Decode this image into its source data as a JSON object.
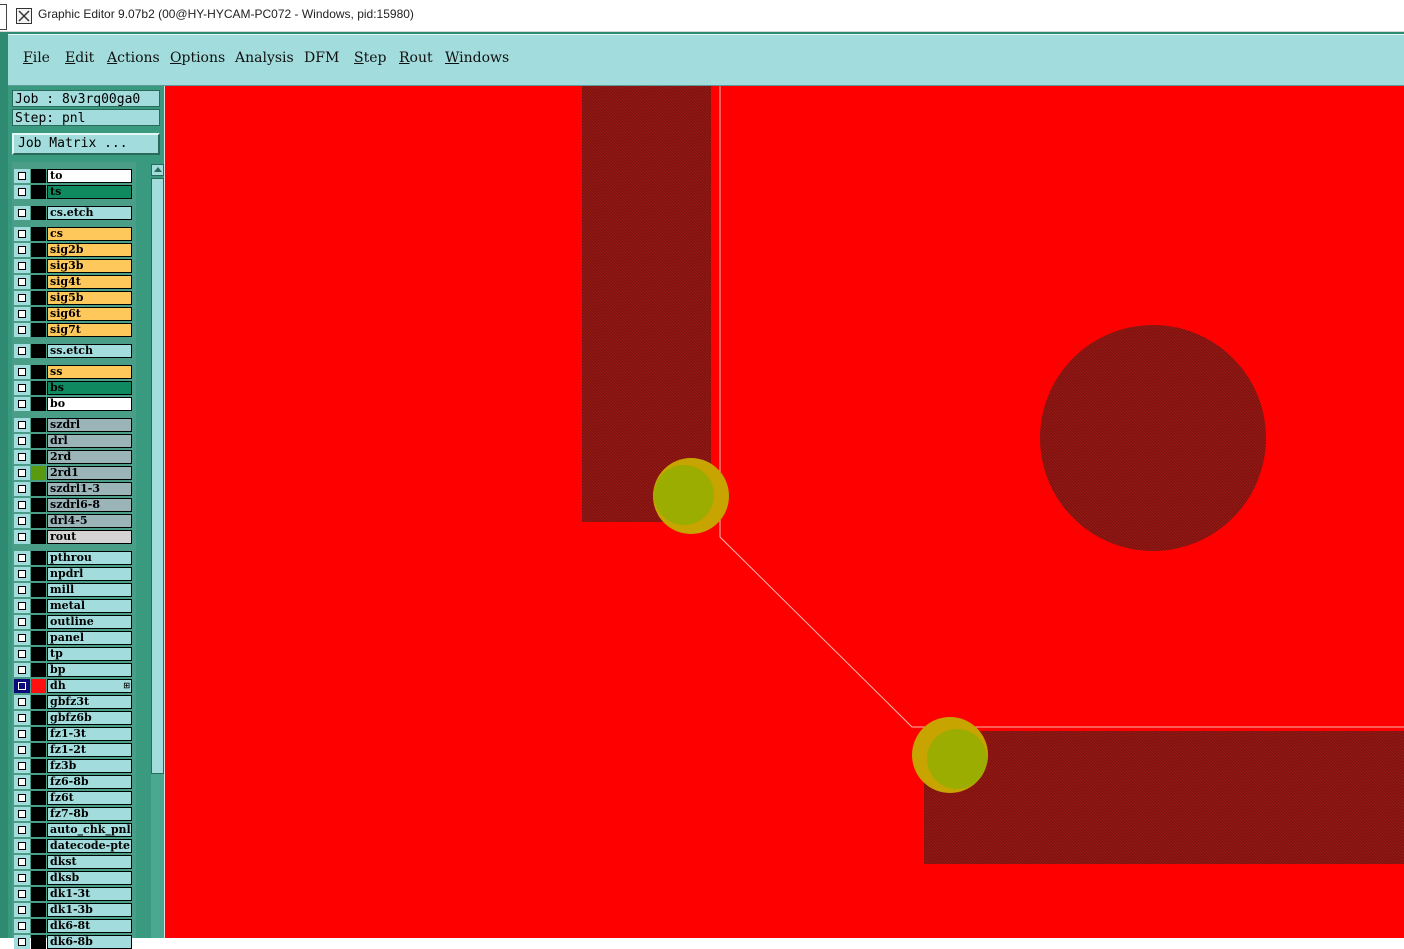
{
  "window": {
    "title": "Graphic Editor 9.07b2 (00@HY-HYCAM-PC072 - Windows, pid:15980)"
  },
  "menu": [
    {
      "label": "File",
      "underline": "F",
      "rest": "ile"
    },
    {
      "label": "Edit",
      "underline": "E",
      "rest": "dit"
    },
    {
      "label": "Actions",
      "underline": "A",
      "rest": "ctions"
    },
    {
      "label": "Options",
      "underline": "O",
      "rest": "ptions"
    },
    {
      "label": "Analysis",
      "underline": "",
      "rest": "Analysis"
    },
    {
      "label": "DFM",
      "underline": "",
      "rest": "DFM"
    },
    {
      "label": "Step",
      "underline": "S",
      "rest": "tep"
    },
    {
      "label": "Rout",
      "underline": "R",
      "rest": "out"
    },
    {
      "label": "Windows",
      "underline": "W",
      "rest": "indows"
    }
  ],
  "job_line": "Job : 8v3rq00ga0",
  "step_line": "Step: pnl",
  "job_matrix_button": "Job Matrix ...",
  "layers": [
    {
      "name": "to",
      "bg": "#ffffff",
      "group": 0
    },
    {
      "name": "ts",
      "bg": "#0f8a60",
      "group": 0
    },
    {
      "name": "cs.etch",
      "bg": "#a2dcdc",
      "group": 1
    },
    {
      "name": "cs",
      "bg": "#ffc85a",
      "group": 2
    },
    {
      "name": "sig2b",
      "bg": "#ffc85a",
      "group": 2
    },
    {
      "name": "sig3b",
      "bg": "#ffc85a",
      "group": 2
    },
    {
      "name": "sig4t",
      "bg": "#ffc85a",
      "group": 2
    },
    {
      "name": "sig5b",
      "bg": "#ffc85a",
      "group": 2
    },
    {
      "name": "sig6t",
      "bg": "#ffc85a",
      "group": 2
    },
    {
      "name": "sig7t",
      "bg": "#ffc85a",
      "group": 2
    },
    {
      "name": "ss.etch",
      "bg": "#a2dcdc",
      "group": 3
    },
    {
      "name": "ss",
      "bg": "#ffc85a",
      "group": 4
    },
    {
      "name": "bs",
      "bg": "#0f8a60",
      "group": 4
    },
    {
      "name": "bo",
      "bg": "#ffffff",
      "group": 4
    },
    {
      "name": "szdrl",
      "bg": "#9ab4b8",
      "group": 5
    },
    {
      "name": "drl",
      "bg": "#9ab4b8",
      "group": 5
    },
    {
      "name": "2rd",
      "bg": "#9ab4b8",
      "group": 5
    },
    {
      "name": "2rd1",
      "bg": "#9ab4b8",
      "group": 5,
      "color": "#5a9a10"
    },
    {
      "name": "szdrl1-3",
      "bg": "#9ab4b8",
      "group": 5
    },
    {
      "name": "szdrl6-8",
      "bg": "#9ab4b8",
      "group": 5
    },
    {
      "name": "drl4-5",
      "bg": "#9ab4b8",
      "group": 5
    },
    {
      "name": "rout",
      "bg": "#d4d4d4",
      "group": 5
    },
    {
      "name": "pthrou",
      "bg": "#a2dcdc",
      "group": 6
    },
    {
      "name": "npdrl",
      "bg": "#a2dcdc",
      "group": 6
    },
    {
      "name": "mill",
      "bg": "#a2dcdc",
      "group": 6
    },
    {
      "name": "metal",
      "bg": "#a2dcdc",
      "group": 6
    },
    {
      "name": "outline",
      "bg": "#a2dcdc",
      "group": 6
    },
    {
      "name": "panel",
      "bg": "#a2dcdc",
      "group": 6
    },
    {
      "name": "tp",
      "bg": "#a2dcdc",
      "group": 6
    },
    {
      "name": "bp",
      "bg": "#a2dcdc",
      "group": 6
    },
    {
      "name": "dh",
      "bg": "#a2dcdc",
      "group": 6,
      "color": "#ff1010",
      "active": true,
      "mark": "⊞"
    },
    {
      "name": "gbfz3t",
      "bg": "#a2dcdc",
      "group": 6
    },
    {
      "name": "gbfz6b",
      "bg": "#a2dcdc",
      "group": 6
    },
    {
      "name": "fz1-3t",
      "bg": "#a2dcdc",
      "group": 6
    },
    {
      "name": "fz1-2t",
      "bg": "#a2dcdc",
      "group": 6
    },
    {
      "name": "fz3b",
      "bg": "#a2dcdc",
      "group": 6
    },
    {
      "name": "fz6-8b",
      "bg": "#a2dcdc",
      "group": 6
    },
    {
      "name": "fz6t",
      "bg": "#a2dcdc",
      "group": 6
    },
    {
      "name": "fz7-8b",
      "bg": "#a2dcdc",
      "group": 6
    },
    {
      "name": "auto_chk_pnl",
      "bg": "#a2dcdc",
      "group": 6
    },
    {
      "name": "datecode-pte",
      "bg": "#a2dcdc",
      "group": 6
    },
    {
      "name": "dkst",
      "bg": "#a2dcdc",
      "group": 6
    },
    {
      "name": "dksb",
      "bg": "#a2dcdc",
      "group": 6
    },
    {
      "name": "dk1-3t",
      "bg": "#a2dcdc",
      "group": 6
    },
    {
      "name": "dk1-3b",
      "bg": "#a2dcdc",
      "group": 6
    },
    {
      "name": "dk6-8t",
      "bg": "#a2dcdc",
      "group": 6
    },
    {
      "name": "dk6-8b",
      "bg": "#a2dcdc",
      "group": 6
    }
  ],
  "colors": {
    "canvas_bg": "#ff0000",
    "feature_dark": "#8a1410",
    "pad_yellow": "#c8a000",
    "pad_green": "#8ab400",
    "profile_line": "#ffb0a8",
    "menu_bg": "#a2dcdc",
    "frame_bg": "#2e8a70"
  }
}
